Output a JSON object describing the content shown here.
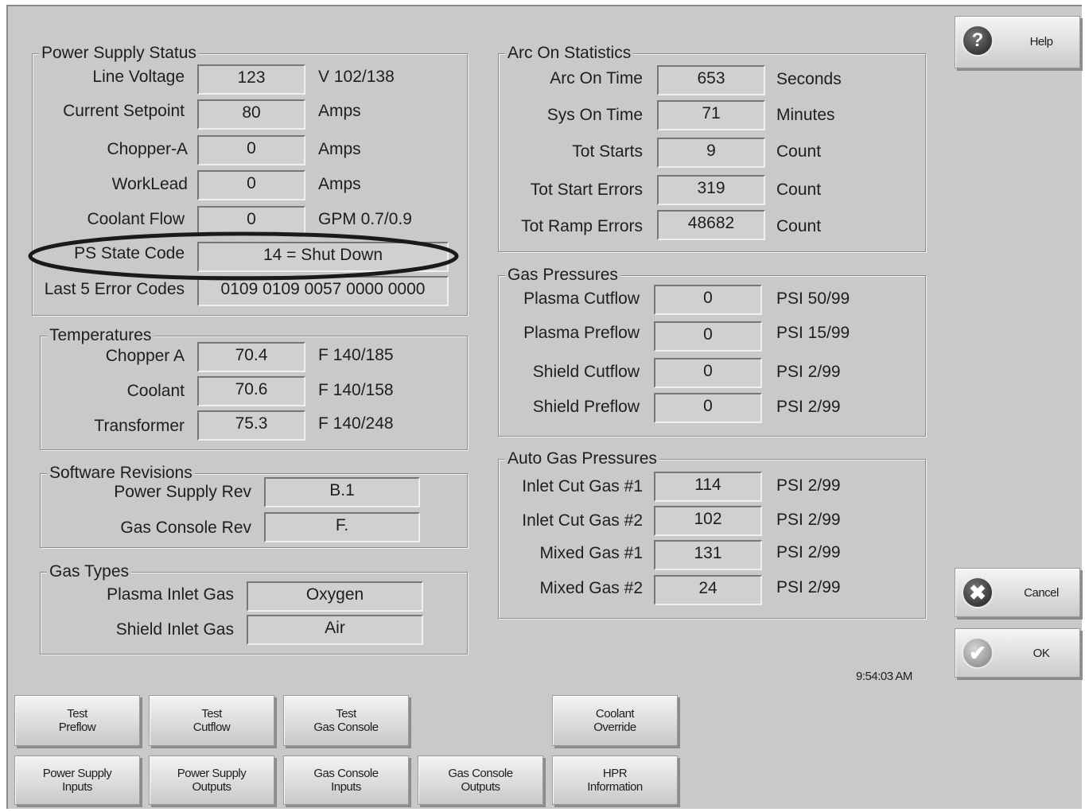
{
  "power_supply_status": {
    "title": "Power Supply Status",
    "rows": [
      {
        "label": "Line Voltage",
        "value": "123",
        "unit": "V 102/138"
      },
      {
        "label": "Current Setpoint",
        "value": "80",
        "unit": "Amps"
      },
      {
        "label": "Chopper-A",
        "value": "0",
        "unit": "Amps"
      },
      {
        "label": "WorkLead",
        "value": "0",
        "unit": "Amps"
      },
      {
        "label": "Coolant Flow",
        "value": "0",
        "unit": "GPM 0.7/0.9"
      }
    ],
    "ps_state_code": {
      "label": "PS State Code",
      "value": "14 = Shut Down"
    },
    "last_errors": {
      "label": "Last 5 Error Codes",
      "value": "0109 0109 0057 0000 0000"
    }
  },
  "temperatures": {
    "title": "Temperatures",
    "rows": [
      {
        "label": "Chopper A",
        "value": "70.4",
        "unit": "F 140/185"
      },
      {
        "label": "Coolant",
        "value": "70.6",
        "unit": "F 140/158"
      },
      {
        "label": "Transformer",
        "value": "75.3",
        "unit": "F 140/248"
      }
    ]
  },
  "software_revisions": {
    "title": "Software Revisions",
    "rows": [
      {
        "label": "Power Supply Rev",
        "value": "B.1"
      },
      {
        "label": "Gas Console Rev",
        "value": "F."
      }
    ]
  },
  "gas_types": {
    "title": "Gas Types",
    "rows": [
      {
        "label": "Plasma Inlet Gas",
        "value": "Oxygen"
      },
      {
        "label": "Shield Inlet Gas",
        "value": "Air"
      }
    ]
  },
  "arc_on_statistics": {
    "title": "Arc On Statistics",
    "rows": [
      {
        "label": "Arc On Time",
        "value": "653",
        "unit": "Seconds"
      },
      {
        "label": "Sys On Time",
        "value": "71",
        "unit": "Minutes"
      },
      {
        "label": "Tot Starts",
        "value": "9",
        "unit": "Count"
      },
      {
        "label": "Tot Start Errors",
        "value": "319",
        "unit": "Count"
      },
      {
        "label": "Tot Ramp Errors",
        "value": "48682",
        "unit": "Count"
      }
    ]
  },
  "gas_pressures": {
    "title": "Gas Pressures",
    "rows": [
      {
        "label": "Plasma Cutflow",
        "value": "0",
        "unit": "PSI 50/99"
      },
      {
        "label": "Plasma Preflow",
        "value": "0",
        "unit": "PSI 15/99"
      },
      {
        "label": "Shield Cutflow",
        "value": "0",
        "unit": "PSI 2/99"
      },
      {
        "label": "Shield Preflow",
        "value": "0",
        "unit": "PSI 2/99"
      }
    ]
  },
  "auto_gas_pressures": {
    "title": "Auto Gas Pressures",
    "rows": [
      {
        "label": "Inlet Cut Gas #1",
        "value": "114",
        "unit": "PSI 2/99"
      },
      {
        "label": "Inlet Cut Gas #2",
        "value": "102",
        "unit": "PSI 2/99"
      },
      {
        "label": "Mixed Gas #1",
        "value": "131",
        "unit": "PSI 2/99"
      },
      {
        "label": "Mixed Gas #2",
        "value": "24",
        "unit": "PSI 2/99"
      }
    ]
  },
  "side_buttons": {
    "help": {
      "label": "Help",
      "icon": "help-icon"
    },
    "cancel": {
      "label": "Cancel",
      "icon": "cancel-icon"
    },
    "ok": {
      "label": "OK",
      "icon": "ok-check-icon"
    }
  },
  "clock": "9:54:03 AM",
  "bottom_buttons": {
    "test_preflow": [
      "Test",
      "Preflow"
    ],
    "test_cutflow": [
      "Test",
      "Cutflow"
    ],
    "test_gas_console": [
      "Test",
      "Gas Console"
    ],
    "coolant_override": [
      "Coolant",
      "Override"
    ],
    "power_supply_inputs": [
      "Power Supply",
      "Inputs"
    ],
    "power_supply_outputs": [
      "Power Supply",
      "Outputs"
    ],
    "gas_console_inputs": [
      "Gas Console",
      "Inputs"
    ],
    "gas_console_outputs": [
      "Gas Console",
      "Outputs"
    ],
    "hpr_information": [
      "HPR",
      "Information"
    ]
  },
  "colors": {
    "panel_bg": "#c9c9c9",
    "annotation_ellipse": "#1a1a1a"
  }
}
